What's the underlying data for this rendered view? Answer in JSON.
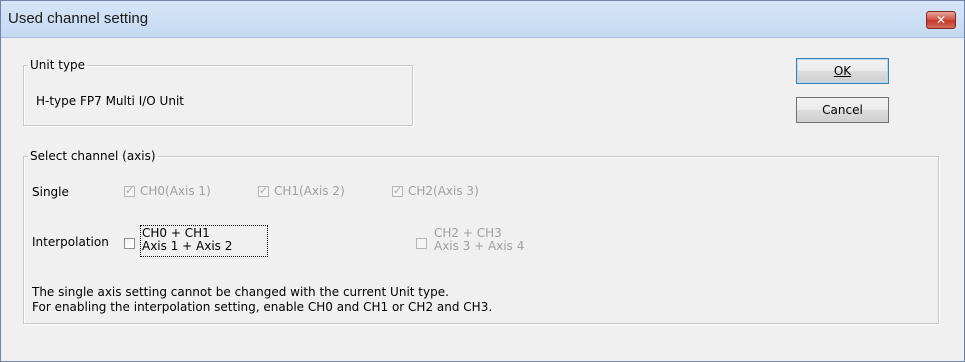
{
  "window": {
    "title": "Used channel setting",
    "close_glyph": "✕"
  },
  "unit_type": {
    "legend": "Unit type",
    "value": "H-type FP7 Multi I/O Unit"
  },
  "buttons": {
    "ok_label": "OK",
    "cancel_label": "Cancel"
  },
  "select_channel": {
    "legend": "Select channel (axis)",
    "single": {
      "label": "Single",
      "options": [
        {
          "label": "CH0(Axis 1)",
          "checked": true,
          "enabled": false
        },
        {
          "label": "CH1(Axis 2)",
          "checked": true,
          "enabled": false
        },
        {
          "label": "CH2(Axis 3)",
          "checked": true,
          "enabled": false
        }
      ]
    },
    "interpolation": {
      "label": "Interpolation",
      "options": [
        {
          "line1": "CH0 + CH1",
          "line2": "Axis 1 + Axis 2",
          "checked": false,
          "enabled": true
        },
        {
          "line1": "CH2 + CH3",
          "line2": "Axis 3 + Axis 4",
          "checked": false,
          "enabled": false
        }
      ]
    },
    "notes": [
      "The single axis setting cannot be changed with the current Unit type.",
      "For enabling the interpolation setting, enable CH0 and CH1 or CH2 and CH3."
    ]
  }
}
